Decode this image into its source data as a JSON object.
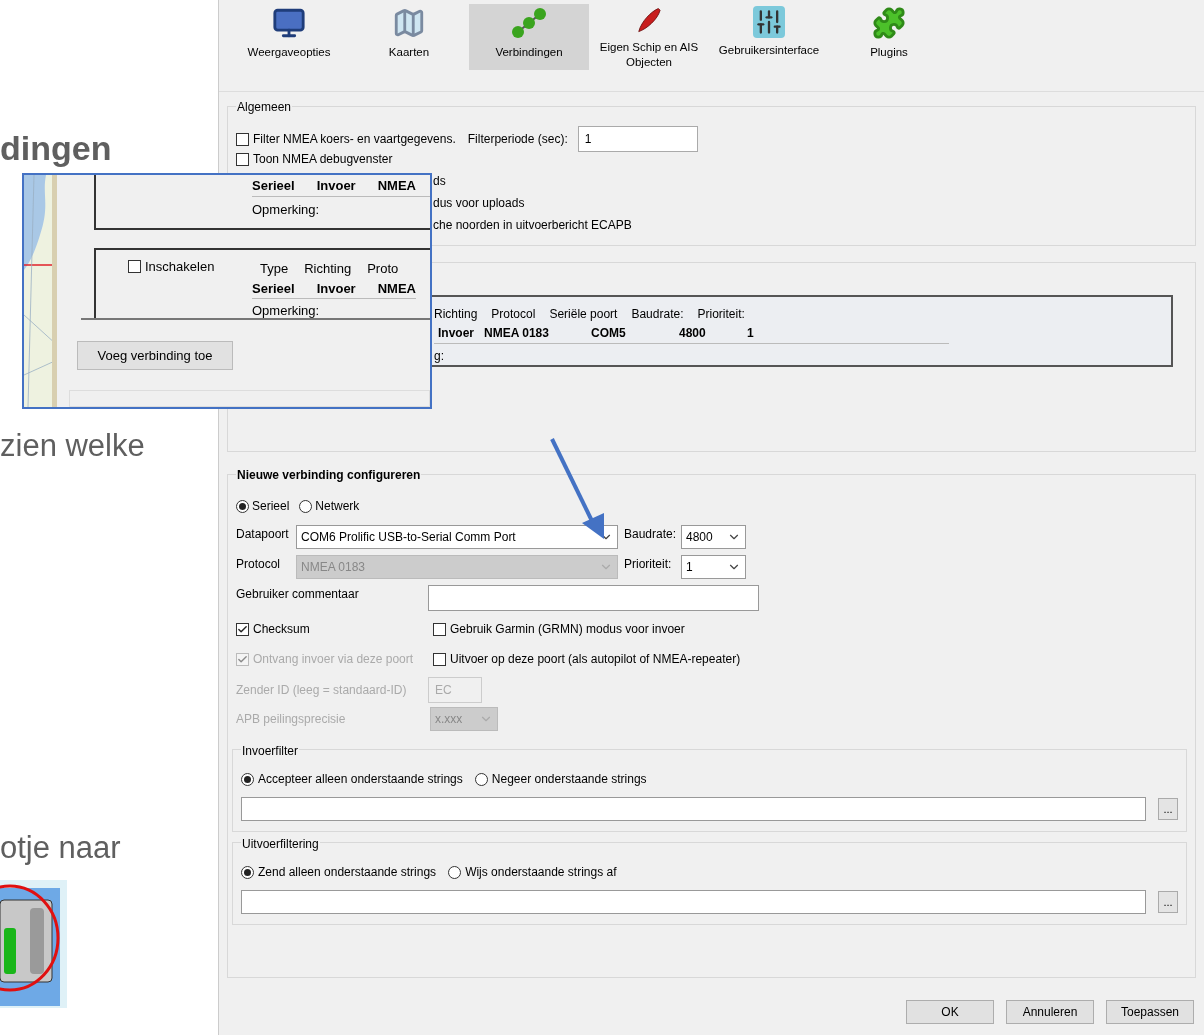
{
  "page_text": [
    {
      "kind": "heading",
      "text": "dingen"
    },
    {
      "kind": "body",
      "text": "zien welke"
    },
    {
      "kind": "body",
      "text": "otje naar"
    }
  ],
  "dialog": {
    "tabs": [
      {
        "label": "Weergaveopties",
        "selected": false,
        "kind": "monitor"
      },
      {
        "label": "Kaarten",
        "selected": false,
        "kind": "map"
      },
      {
        "label": "Verbindingen",
        "selected": true,
        "kind": "connections"
      },
      {
        "label": "Eigen Schip en AIS Objecten",
        "selected": false,
        "kind": "ship"
      },
      {
        "label": "Gebruikersinterface",
        "selected": false,
        "kind": "sliders"
      },
      {
        "label": "Plugins",
        "selected": false,
        "kind": "plugin"
      }
    ],
    "general": {
      "title": "Algemeen",
      "filter": {
        "label": "Filter NMEA koers- en vaartgegevens.",
        "checked": false
      },
      "period_label": "Filterperiode (sec):",
      "period_value": "1",
      "debug": {
        "label": "Toon NMEA debugvenster",
        "checked": false
      },
      "partial_lines": [
        "ds",
        "dus voor uploads",
        "che noorden in uitvoerbericht ECAPB"
      ]
    },
    "connection": {
      "headers": [
        "Richting",
        "Protocol",
        "Seriële poort",
        "Baudrate:",
        "Prioriteit:"
      ],
      "values": [
        "Invoer",
        "NMEA 0183",
        "COM5",
        "4800",
        "1"
      ],
      "comment": "g:"
    },
    "new_connection": {
      "title": "Nieuwe verbinding configureren",
      "types": [
        {
          "label": "Serieel",
          "selected": true
        },
        {
          "label": "Netwerk",
          "selected": false
        }
      ],
      "port_label": "Datapoort",
      "port_value": "COM6 Prolific USB-to-Serial Comm Port",
      "baud_label": "Baudrate:",
      "baud_value": "4800",
      "protocol_label": "Protocol",
      "protocol_value": "NMEA 0183",
      "protocol_disabled": true,
      "priority_label": "Prioriteit:",
      "priority_value": "1",
      "comment_label": "Gebruiker commentaar",
      "options": [
        {
          "label": "Checksum",
          "checked": true,
          "disabled": false
        },
        {
          "label": "Gebruik Garmin (GRMN) modus voor invoer",
          "checked": false,
          "disabled": false
        },
        {
          "label": "Ontvang invoer via deze poort",
          "checked": true,
          "disabled": true
        },
        {
          "label": "Uitvoer op deze poort (als autopilot of NMEA-repeater)",
          "checked": false,
          "disabled": false
        }
      ],
      "talker_label": "Zender ID (leeg = standaard-ID)",
      "talker_value": "EC",
      "apb_label": "APB peilingsprecisie",
      "apb_value": "x.xxx",
      "extra_disabled": true
    },
    "filters": [
      {
        "title": "Invoerfilter",
        "modes": [
          {
            "label": "Accepteer alleen onderstaande strings",
            "selected": true
          },
          {
            "label": "Negeer onderstaande strings",
            "selected": false
          }
        ],
        "browse": "..."
      },
      {
        "title": "Uitvoerfiltering",
        "modes": [
          {
            "label": "Zend alleen onderstaande strings",
            "selected": true
          },
          {
            "label": "Wijs onderstaande strings af",
            "selected": false
          }
        ],
        "browse": "..."
      }
    ],
    "buttons": [
      "OK",
      "Annuleren",
      "Toepassen"
    ]
  },
  "inset": {
    "entries": [
      {
        "values": [
          "Serieel",
          "Invoer",
          "NMEA"
        ],
        "comment": "Opmerking:"
      },
      {
        "enable": {
          "label": "Inschakelen",
          "checked": false
        },
        "headers": [
          "Type",
          "Richting",
          "Proto"
        ],
        "values": [
          "Serieel",
          "Invoer",
          "NMEA"
        ],
        "comment": "Opmerking:"
      }
    ],
    "add_button": "Voeg verbinding toe"
  }
}
